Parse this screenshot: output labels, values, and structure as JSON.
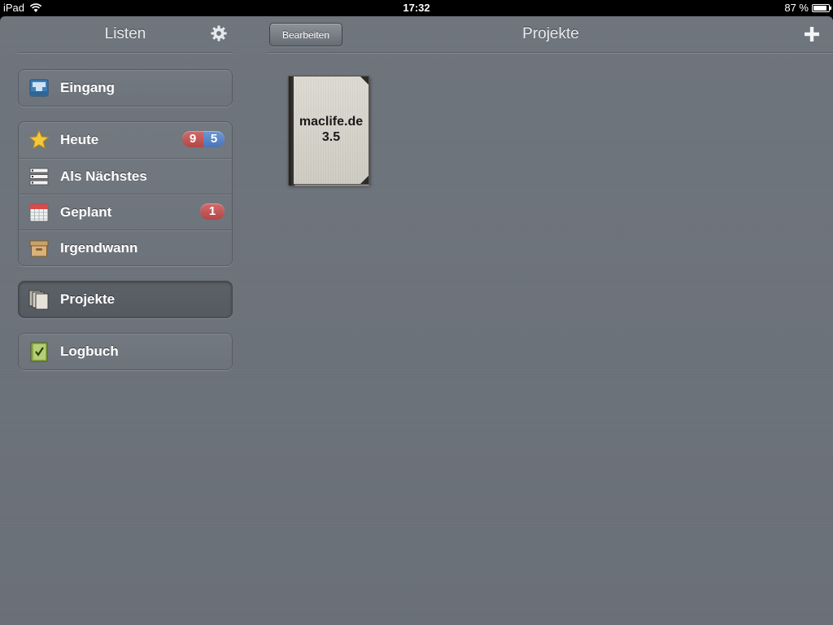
{
  "statusbar": {
    "device": "iPad",
    "time": "17:32",
    "battery_text": "87 %",
    "battery_level": 0.87
  },
  "sidebar": {
    "title": "Listen",
    "settings_icon": "gear-icon",
    "groups": [
      {
        "items": [
          {
            "label": "Eingang",
            "icon": "inbox-tray-icon"
          }
        ]
      },
      {
        "items": [
          {
            "label": "Heute",
            "icon": "star-icon",
            "badges": [
              {
                "value": "9",
                "color": "#c05656"
              },
              {
                "value": "5",
                "color": "#5a83c6"
              }
            ]
          },
          {
            "label": "Als Nächstes",
            "icon": "list-icon"
          },
          {
            "label": "Geplant",
            "icon": "calendar-icon",
            "badges": [
              {
                "value": "1",
                "color": "#c05656"
              }
            ]
          },
          {
            "label": "Irgendwann",
            "icon": "archive-box-icon"
          }
        ]
      },
      {
        "selected": true,
        "items": [
          {
            "label": "Projekte",
            "icon": "projects-stack-icon"
          }
        ]
      },
      {
        "items": [
          {
            "label": "Logbuch",
            "icon": "logbook-check-icon"
          }
        ]
      }
    ]
  },
  "main": {
    "title": "Projekte",
    "edit_label": "Bearbeiten",
    "add_icon": "plus-icon",
    "projects": [
      {
        "line1": "maclife.de",
        "line2": "3.5"
      }
    ]
  }
}
